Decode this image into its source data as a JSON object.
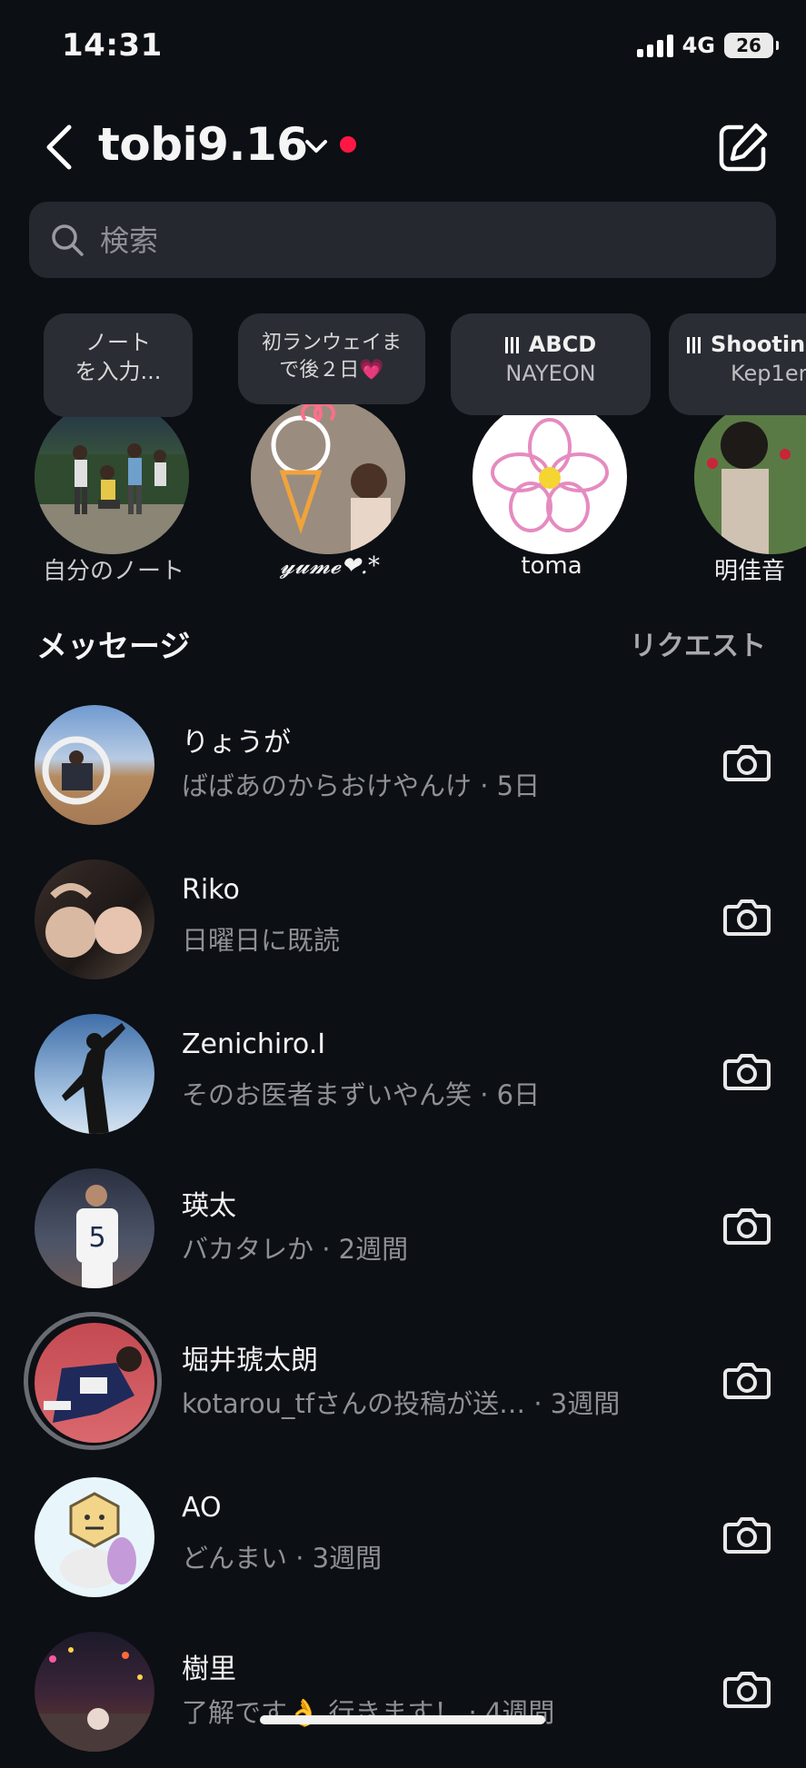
{
  "status": {
    "time": "14:31",
    "network": "4G",
    "battery": "26"
  },
  "header": {
    "username": "tobi9.16"
  },
  "search": {
    "placeholder": "検索"
  },
  "notes": [
    {
      "bubble_line1": "ノート",
      "bubble_line2": "を入力...",
      "name": "自分のノート"
    },
    {
      "bubble_line1": "初ランウェイま",
      "bubble_line2": "で後２日💗",
      "name": "𝔂𝓾𝓶𝓮❤︎.*"
    },
    {
      "bubble_line1": "ABCD",
      "bubble_line2": "NAYEON",
      "name": "toma"
    },
    {
      "bubble_line1": "Shootin",
      "bubble_line2": "Kep1er",
      "name": "明佳音"
    }
  ],
  "messages": {
    "title": "メッセージ",
    "requests": "リクエスト",
    "threads": [
      {
        "name": "りょうが",
        "preview": "ばばあのからおけやんけ · 5日"
      },
      {
        "name": "Riko",
        "preview": "日曜日に既読"
      },
      {
        "name": "Zenichiro.I",
        "preview": "そのお医者まずいやん笑 · 6日"
      },
      {
        "name": "瑛太",
        "preview": "バカタレか · 2週間"
      },
      {
        "name": "堀井琥太朗",
        "preview": "kotarou_tfさんの投稿が送…  · 3週間"
      },
      {
        "name": "AO",
        "preview": "どんまい · 3週間"
      },
      {
        "name": "樹里",
        "preview": "了解です👌 行きます！ · 4週間"
      }
    ]
  }
}
